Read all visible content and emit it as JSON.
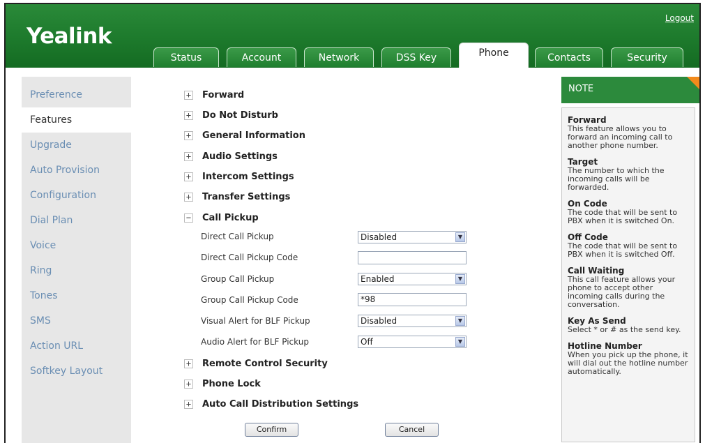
{
  "header": {
    "logo": "Yealink",
    "logout": "Logout",
    "tabs": [
      {
        "label": "Status"
      },
      {
        "label": "Account"
      },
      {
        "label": "Network"
      },
      {
        "label": "DSS Key"
      },
      {
        "label": "Phone"
      },
      {
        "label": "Contacts"
      },
      {
        "label": "Security"
      }
    ]
  },
  "sidebar": {
    "items": [
      {
        "label": "Preference"
      },
      {
        "label": "Features"
      },
      {
        "label": "Upgrade"
      },
      {
        "label": "Auto Provision"
      },
      {
        "label": "Configuration"
      },
      {
        "label": "Dial Plan"
      },
      {
        "label": "Voice"
      },
      {
        "label": "Ring"
      },
      {
        "label": "Tones"
      },
      {
        "label": "SMS"
      },
      {
        "label": "Action URL"
      },
      {
        "label": "Softkey Layout"
      }
    ]
  },
  "sections": {
    "forward": {
      "icon": "+",
      "label": "Forward"
    },
    "dnd": {
      "icon": "+",
      "label": "Do Not Disturb"
    },
    "general": {
      "icon": "+",
      "label": "General Information"
    },
    "audio": {
      "icon": "+",
      "label": "Audio Settings"
    },
    "intercom": {
      "icon": "+",
      "label": "Intercom Settings"
    },
    "transfer": {
      "icon": "+",
      "label": "Transfer Settings"
    },
    "pickup": {
      "icon": "−",
      "label": "Call Pickup"
    },
    "remote": {
      "icon": "+",
      "label": "Remote Control Security"
    },
    "lock": {
      "icon": "+",
      "label": "Phone Lock"
    },
    "acd": {
      "icon": "+",
      "label": "Auto Call Distribution Settings"
    }
  },
  "pickup": {
    "direct": {
      "label": "Direct Call Pickup",
      "value": "Disabled"
    },
    "direct_code": {
      "label": "Direct Call Pickup Code",
      "value": ""
    },
    "group": {
      "label": "Group Call Pickup",
      "value": "Enabled"
    },
    "group_code": {
      "label": "Group Call Pickup Code",
      "value": "*98"
    },
    "visual": {
      "label": "Visual Alert for BLF Pickup",
      "value": "Disabled"
    },
    "audio": {
      "label": "Audio Alert for BLF Pickup",
      "value": "Off"
    }
  },
  "buttons": {
    "confirm": "Confirm",
    "cancel": "Cancel"
  },
  "note": {
    "title": "NOTE",
    "items": [
      {
        "title": "Forward",
        "text": "This feature allows you to forward an incoming call to another phone number."
      },
      {
        "title": "Target",
        "text": "The number to which the incoming calls will be forwarded."
      },
      {
        "title": "On Code",
        "text": "The code that will be sent to PBX when it is switched On."
      },
      {
        "title": "Off Code",
        "text": "The code that will be sent to PBX when it is switched Off."
      },
      {
        "title": "Call Waiting",
        "text": "This call feature allows your phone to accept other incoming calls during the conversation."
      },
      {
        "title": "Key As Send",
        "text": "Select * or # as the send key."
      },
      {
        "title": "Hotline Number",
        "text": "When you pick up the phone, it will dial out the hotline number automatically."
      }
    ]
  },
  "colors": {
    "brand": "#1f7f2f",
    "note_corner": "#f28a1c",
    "sidebar_link": "#6a8eb3"
  }
}
